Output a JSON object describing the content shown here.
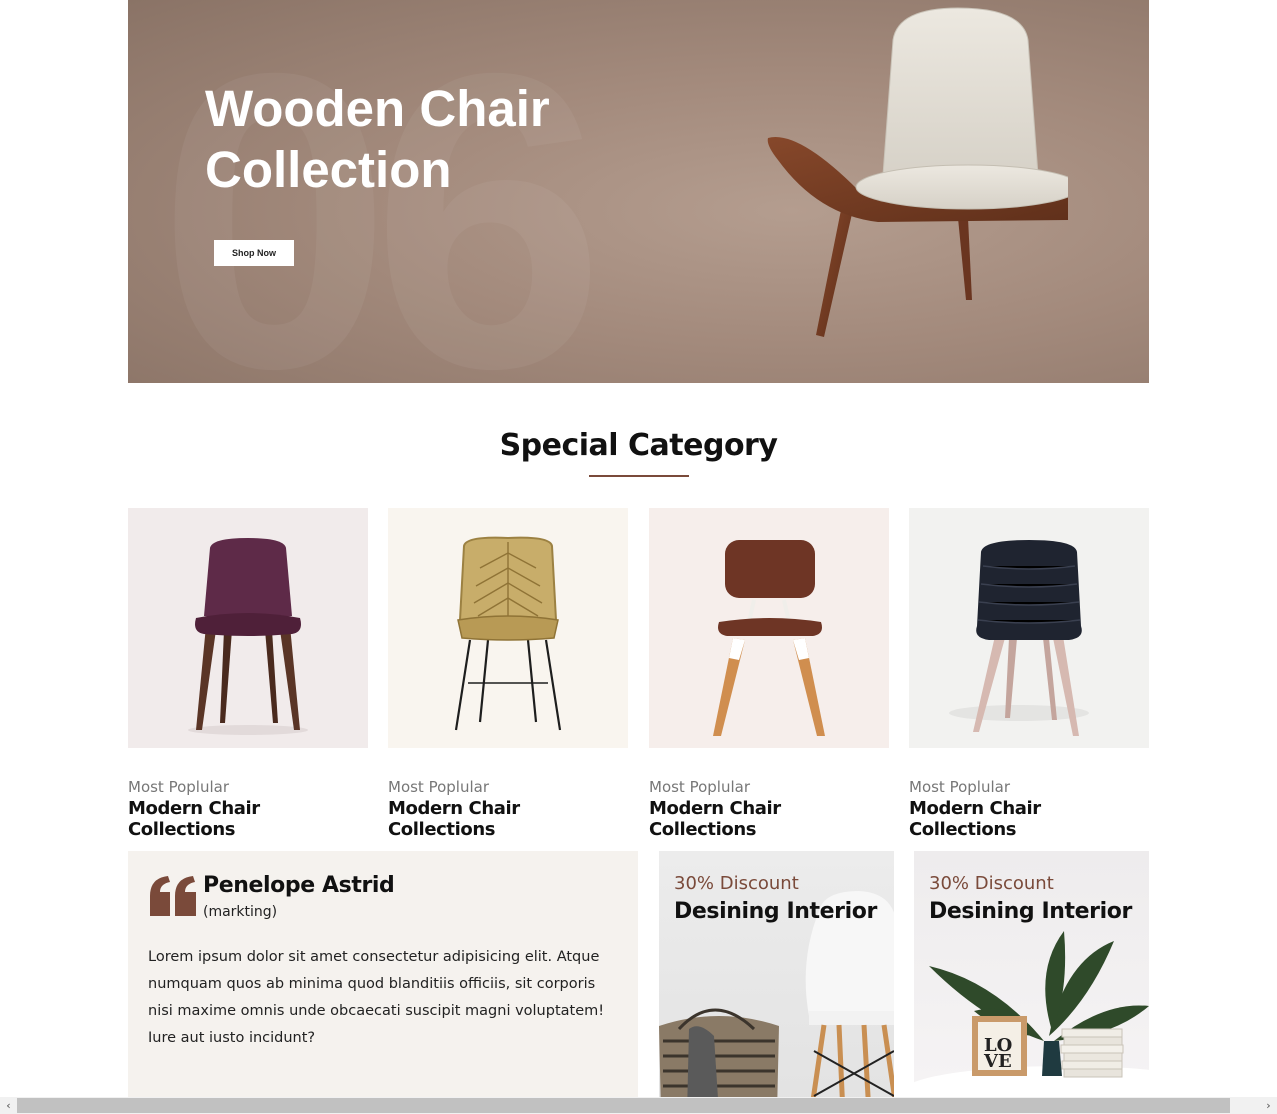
{
  "hero": {
    "title": "Wooden Chair Collection",
    "button_label": "Shop Now"
  },
  "special_category": {
    "title": "Special Category",
    "items": [
      {
        "subtitle": "Most Poplular",
        "title": "Modern Chair Collections",
        "bg": "#f1ebeb",
        "chair_color": "#5e2a48"
      },
      {
        "subtitle": "Most Poplular",
        "title": "Modern Chair Collections",
        "bg": "#f9f5ef",
        "chair_color": "#b89a55"
      },
      {
        "subtitle": "Most Poplular",
        "title": "Modern Chair Collections",
        "bg": "#f6eeeb",
        "chair_color": "#6e3525"
      },
      {
        "subtitle": "Most Poplular",
        "title": "Modern Chair Collections",
        "bg": "#f2f2f0",
        "chair_color": "#1f2430"
      }
    ]
  },
  "testimonial": {
    "name": "Penelope Astrid",
    "role": "(markting)",
    "text": "Lorem ipsum dolor sit amet consectetur adipisicing elit. Atque numquam quos ab minima quod blanditiis officiis, sit corporis nisi maxime omnis unde obcaecati suscipit magni voluptatem! Iure aut iusto incidunt?"
  },
  "promos": [
    {
      "subtitle": "30% Discount",
      "title": "Desining Interior"
    },
    {
      "subtitle": "30% Discount",
      "title": "Desining Interior"
    }
  ],
  "colors": {
    "accent": "#7a4a3a",
    "hero_bg": "#a38a7c",
    "testimonial_bg": "#f5f2ee"
  },
  "scrollbar": {
    "left_arrow": "‹",
    "right_arrow": "›"
  }
}
